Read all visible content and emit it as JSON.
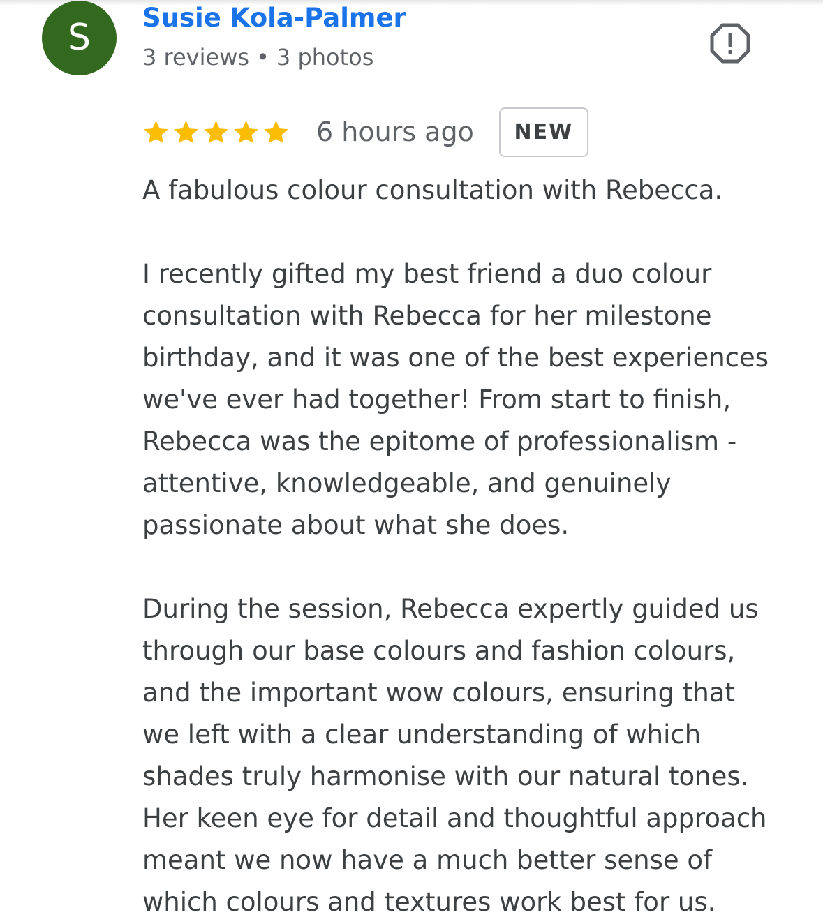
{
  "reviewer": {
    "avatar_letter": "S",
    "avatar_color": "#33691e",
    "name": "Susie Kola-Palmer",
    "reviews": "3 reviews",
    "separator": "•",
    "photos": "3 photos"
  },
  "report": {
    "icon": "report-flag-icon"
  },
  "rating": {
    "stars": 5,
    "max_stars": 5,
    "star_color": "#fbbc04",
    "time_ago": "6 hours ago",
    "badge": "NEW"
  },
  "review": {
    "paragraphs": [
      {
        "lines": [
          "A fabulous colour consultation with Rebecca."
        ]
      },
      {
        "lines": [
          "I recently gifted my best friend a duo colour",
          "consultation with Rebecca for her milestone",
          "birthday, and it was one of the best experiences",
          "we've ever had together! From start to finish,",
          "Rebecca was the epitome of professionalism -",
          "attentive, knowledgeable, and genuinely",
          "passionate about what she does."
        ]
      },
      {
        "lines": [
          "During the session, Rebecca expertly guided us",
          "through our base colours and fashion colours,",
          "and the important wow colours, ensuring that",
          "we left with a clear understanding of which",
          "shades truly harmonise with our natural tones.",
          "Her keen eye for detail and thoughtful approach",
          "meant we now have a much better sense of",
          "which colours and textures work best for us."
        ]
      }
    ]
  }
}
